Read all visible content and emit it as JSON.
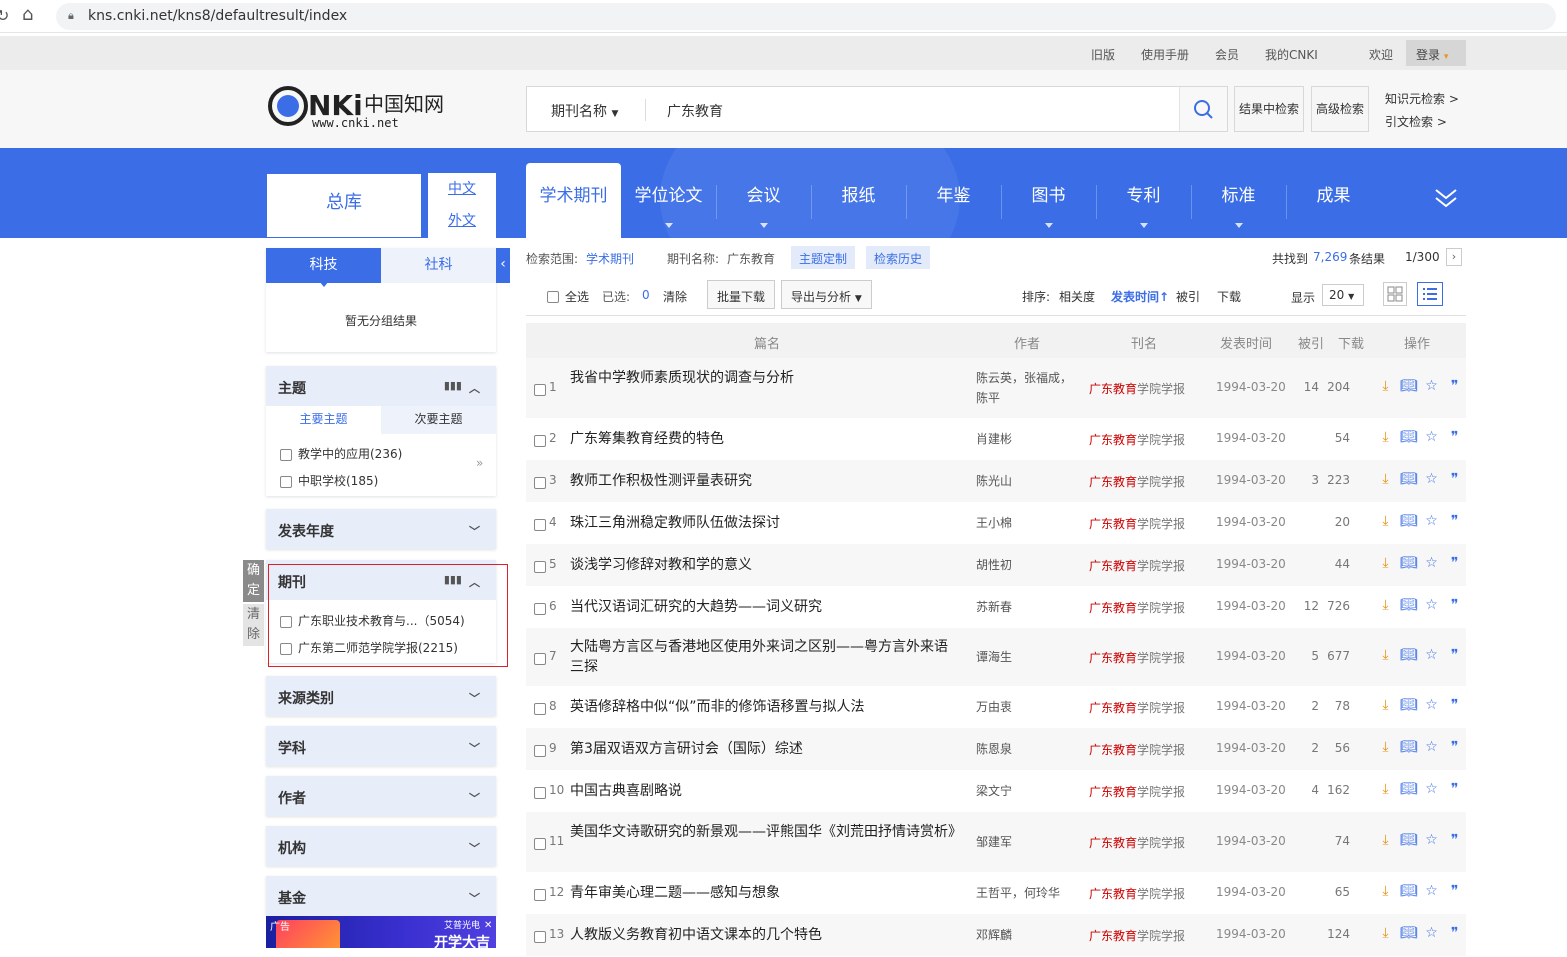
{
  "browser": {
    "url": "kns.cnki.net/kns8/defaultresult/index"
  },
  "topnav": {
    "old_version": "旧版",
    "manual": "使用手册",
    "member": "会员",
    "my_cnki": "我的CNKI",
    "welcome": "欢迎",
    "login": "登录"
  },
  "logo": {
    "text": "CNKI中国知网",
    "url_text": "www.cnki.net"
  },
  "search": {
    "field": "期刊名称",
    "keyword": "广东教育"
  },
  "header_buttons": {
    "in_results": "结果中检索",
    "advanced": "高级检索"
  },
  "side_links": {
    "knowledge": "知识元检索 >",
    "citation": "引文检索 >"
  },
  "db": {
    "total": "总库",
    "chinese": "中文",
    "foreign": "外文"
  },
  "nav_tabs": [
    "学术期刊",
    "学位论文",
    "会议",
    "报纸",
    "年鉴",
    "图书",
    "专利",
    "标准",
    "成果"
  ],
  "sidebar": {
    "subject_tabs": [
      "科技",
      "社科"
    ],
    "no_group": "暂无分组结果",
    "topic": {
      "title": "主题",
      "tabs": [
        "主要主题",
        "次要主题"
      ],
      "items": [
        "教学中的应用(236)",
        "中职学校(185)"
      ]
    },
    "year": {
      "title": "发表年度"
    },
    "journal": {
      "title": "期刊",
      "items": [
        "广东职业技术教育与...（5054)",
        "广东第二师范学院学报(2215)"
      ]
    },
    "confirm": "确定",
    "clear": "清除",
    "source": {
      "title": "来源类别"
    },
    "discipline": {
      "title": "学科"
    },
    "author": {
      "title": "作者"
    },
    "institution": {
      "title": "机构"
    },
    "fund": {
      "title": "基金"
    },
    "ad": {
      "label": "广告",
      "brand": "艾普光电",
      "slogan": "开学大吉"
    }
  },
  "scope": {
    "label": "检索范围:",
    "value": "学术期刊",
    "journal_label": "期刊名称:",
    "journal_value": "广东教育",
    "topic_custom": "主题定制",
    "history": "检索历史"
  },
  "result": {
    "prefix": "共找到",
    "count": "7,269",
    "suffix": "条结果",
    "page": "1/300"
  },
  "toolbar": {
    "select_all": "全选",
    "selected_label": "已选:",
    "selected_count": "0",
    "clear": "清除",
    "batch_download": "批量下载",
    "export": "导出与分析",
    "sort_label": "排序:",
    "sort_relevance": "相关度",
    "sort_date": "发表时间",
    "sort_cited": "被引",
    "sort_download": "下载",
    "display_label": "显示",
    "display_count": "20"
  },
  "columns": {
    "title": "篇名",
    "author": "作者",
    "journal": "刊名",
    "date": "发表时间",
    "cited": "被引",
    "downloads": "下载",
    "ops": "操作"
  },
  "rows": [
    {
      "n": "1",
      "title": "我省中学教师素质现状的调查与分析",
      "author": "陈云英，张福成，陈平",
      "jh": "广东教育",
      "jr": "学院学报",
      "date": "1994-03-20",
      "cited": "14",
      "dl": "204"
    },
    {
      "n": "2",
      "title": "广东筹集教育经费的特色",
      "author": "肖建彬",
      "jh": "广东教育",
      "jr": "学院学报",
      "date": "1994-03-20",
      "cited": "",
      "dl": "54"
    },
    {
      "n": "3",
      "title": "教师工作积极性测评量表研究",
      "author": "陈光山",
      "jh": "广东教育",
      "jr": "学院学报",
      "date": "1994-03-20",
      "cited": "3",
      "dl": "223"
    },
    {
      "n": "4",
      "title": "珠江三角洲稳定教师队伍做法探讨",
      "author": "王小棉",
      "jh": "广东教育",
      "jr": "学院学报",
      "date": "1994-03-20",
      "cited": "",
      "dl": "20"
    },
    {
      "n": "5",
      "title": "谈浅学习修辞对教和学的意义",
      "author": "胡性初",
      "jh": "广东教育",
      "jr": "学院学报",
      "date": "1994-03-20",
      "cited": "",
      "dl": "44"
    },
    {
      "n": "6",
      "title": "当代汉语词汇研究的大趋势——词义研究",
      "author": "苏新春",
      "jh": "广东教育",
      "jr": "学院学报",
      "date": "1994-03-20",
      "cited": "12",
      "dl": "726"
    },
    {
      "n": "7",
      "title": "大陆粤方言区与香港地区使用外来词之区别——粤方言外来语三探",
      "author": "谭海生",
      "jh": "广东教育",
      "jr": "学院学报",
      "date": "1994-03-20",
      "cited": "5",
      "dl": "677"
    },
    {
      "n": "8",
      "title": "英语修辞格中似“似”而非的修饰语移置与拟人法",
      "author": "万由衷",
      "jh": "广东教育",
      "jr": "学院学报",
      "date": "1994-03-20",
      "cited": "2",
      "dl": "78"
    },
    {
      "n": "9",
      "title": "第3届双语双方言研讨会（国际）综述",
      "author": "陈恩泉",
      "jh": "广东教育",
      "jr": "学院学报",
      "date": "1994-03-20",
      "cited": "2",
      "dl": "56"
    },
    {
      "n": "10",
      "title": "中国古典喜剧略说",
      "author": "梁文宁",
      "jh": "广东教育",
      "jr": "学院学报",
      "date": "1994-03-20",
      "cited": "4",
      "dl": "162"
    },
    {
      "n": "11",
      "title": "美国华文诗歌研究的新景观——评熊国华《刘荒田抒情诗赏析》",
      "author": "邹建军",
      "jh": "广东教育",
      "jr": "学院学报",
      "date": "1994-03-20",
      "cited": "",
      "dl": "74"
    },
    {
      "n": "12",
      "title": "青年审美心理二题——感知与想象",
      "author": "王哲平，何玲华",
      "jh": "广东教育",
      "jr": "学院学报",
      "date": "1994-03-20",
      "cited": "",
      "dl": "65"
    },
    {
      "n": "13",
      "title": "人教版义务教育初中语文课本的几个特色",
      "author": "邓辉麟",
      "jh": "广东教育",
      "jr": "学院学报",
      "date": "1994-03-20",
      "cited": "",
      "dl": "124"
    }
  ]
}
